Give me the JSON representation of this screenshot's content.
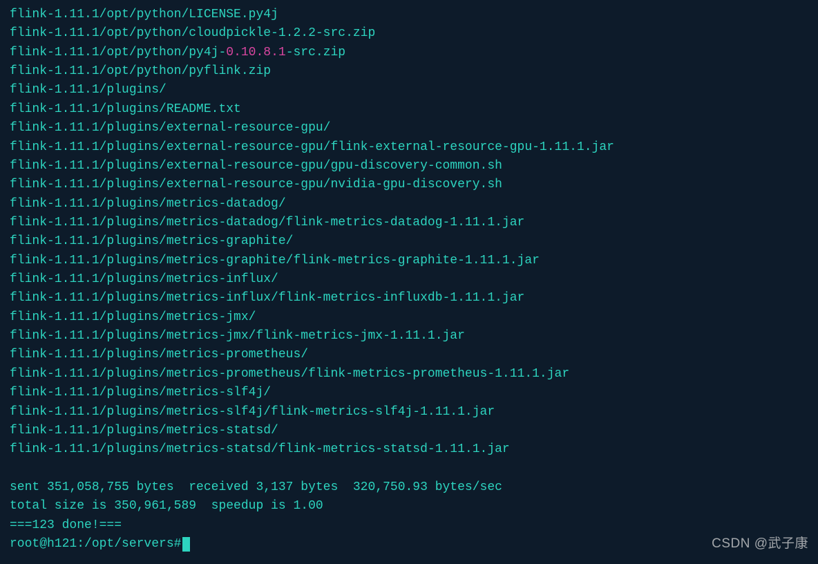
{
  "terminal": {
    "lines": [
      {
        "type": "plain",
        "text": "flink-1.11.1/opt/python/LICENSE.py4j"
      },
      {
        "type": "plain",
        "text": "flink-1.11.1/opt/python/cloudpickle-1.2.2-src.zip"
      },
      {
        "type": "highlighted",
        "prefix": "flink-1.11.1/opt/python/py4j-",
        "highlight": "0.10.8.1",
        "suffix": "-src.zip"
      },
      {
        "type": "plain",
        "text": "flink-1.11.1/opt/python/pyflink.zip"
      },
      {
        "type": "plain",
        "text": "flink-1.11.1/plugins/"
      },
      {
        "type": "plain",
        "text": "flink-1.11.1/plugins/README.txt"
      },
      {
        "type": "plain",
        "text": "flink-1.11.1/plugins/external-resource-gpu/"
      },
      {
        "type": "plain",
        "text": "flink-1.11.1/plugins/external-resource-gpu/flink-external-resource-gpu-1.11.1.jar"
      },
      {
        "type": "plain",
        "text": "flink-1.11.1/plugins/external-resource-gpu/gpu-discovery-common.sh"
      },
      {
        "type": "plain",
        "text": "flink-1.11.1/plugins/external-resource-gpu/nvidia-gpu-discovery.sh"
      },
      {
        "type": "plain",
        "text": "flink-1.11.1/plugins/metrics-datadog/"
      },
      {
        "type": "plain",
        "text": "flink-1.11.1/plugins/metrics-datadog/flink-metrics-datadog-1.11.1.jar"
      },
      {
        "type": "plain",
        "text": "flink-1.11.1/plugins/metrics-graphite/"
      },
      {
        "type": "plain",
        "text": "flink-1.11.1/plugins/metrics-graphite/flink-metrics-graphite-1.11.1.jar"
      },
      {
        "type": "plain",
        "text": "flink-1.11.1/plugins/metrics-influx/"
      },
      {
        "type": "plain",
        "text": "flink-1.11.1/plugins/metrics-influx/flink-metrics-influxdb-1.11.1.jar"
      },
      {
        "type": "plain",
        "text": "flink-1.11.1/plugins/metrics-jmx/"
      },
      {
        "type": "plain",
        "text": "flink-1.11.1/plugins/metrics-jmx/flink-metrics-jmx-1.11.1.jar"
      },
      {
        "type": "plain",
        "text": "flink-1.11.1/plugins/metrics-prometheus/"
      },
      {
        "type": "plain",
        "text": "flink-1.11.1/plugins/metrics-prometheus/flink-metrics-prometheus-1.11.1.jar"
      },
      {
        "type": "plain",
        "text": "flink-1.11.1/plugins/metrics-slf4j/"
      },
      {
        "type": "plain",
        "text": "flink-1.11.1/plugins/metrics-slf4j/flink-metrics-slf4j-1.11.1.jar"
      },
      {
        "type": "plain",
        "text": "flink-1.11.1/plugins/metrics-statsd/"
      },
      {
        "type": "plain",
        "text": "flink-1.11.1/plugins/metrics-statsd/flink-metrics-statsd-1.11.1.jar"
      },
      {
        "type": "plain",
        "text": ""
      },
      {
        "type": "plain",
        "text": "sent 351,058,755 bytes  received 3,137 bytes  320,750.93 bytes/sec"
      },
      {
        "type": "plain",
        "text": "total size is 350,961,589  speedup is 1.00"
      },
      {
        "type": "plain",
        "text": "===123 done!==="
      }
    ],
    "prompt": "root@h121:/opt/servers# "
  },
  "watermark": "CSDN @武子康"
}
